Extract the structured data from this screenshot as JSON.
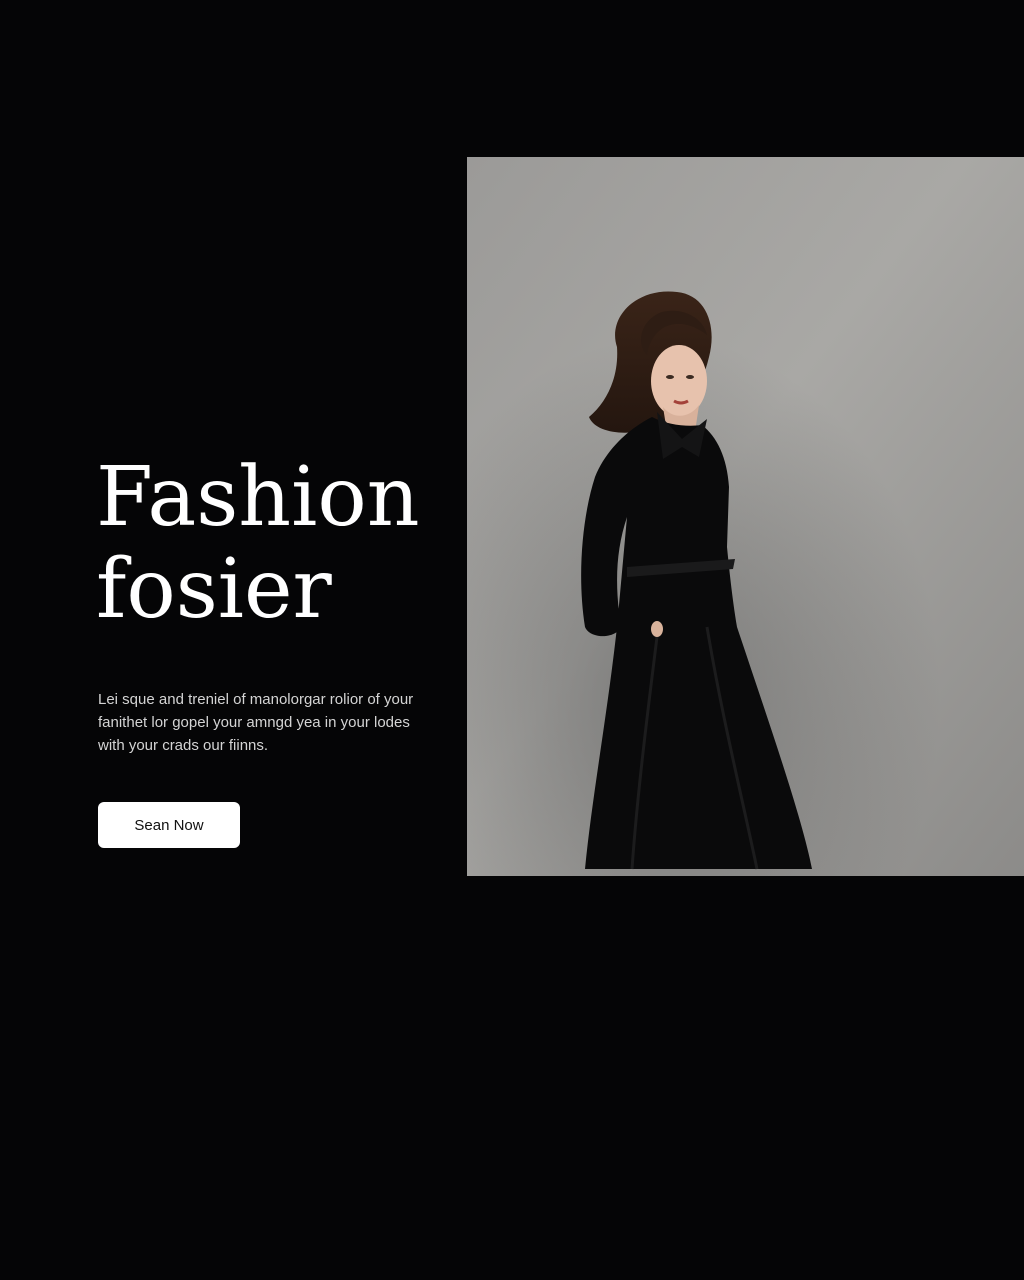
{
  "hero": {
    "title_line1": "Fashion",
    "title_line2": "fosier",
    "body_lines": [
      "Lei sque and treniel of manolorgar rolior of your",
      "fanithet lor gopel your amngd yea in your lodes",
      "with your crads our fiinns."
    ],
    "cta_label": "Sean Now"
  },
  "photo": {
    "subject": "model in long black coat against grey backdrop"
  },
  "colors": {
    "background": "#050506",
    "text": "#ffffff",
    "button": "#ffffff",
    "backdrop": "#a9a8a5"
  }
}
